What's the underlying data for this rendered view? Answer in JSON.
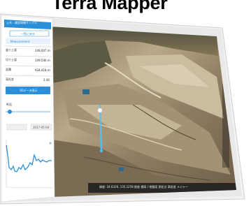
{
  "title": "Terra Mapper",
  "panel": {
    "header": "土木・建設現場サンプル",
    "button_top": "一覧に戻る",
    "tab_label": "Measurement",
    "rows": [
      {
        "label": "盛り土量",
        "value": "149,007 m"
      },
      {
        "label": "切り土量",
        "value": "149,540 m"
      },
      {
        "label": "面積",
        "value": "¥34,418 m"
      },
      {
        "label": "高低差",
        "value": "2.44"
      }
    ],
    "action_button": "3Dデータ表示",
    "section_label": "断面",
    "date_value": "2017-05-04"
  },
  "map": {
    "status_bar": "緯度: 34.6326, 135.1258  経度  標高 / 地盤面  測定点  高低差  メジャー"
  },
  "colors": {
    "accent": "#2a8fd8",
    "profile_line": "#2a8fd8"
  }
}
